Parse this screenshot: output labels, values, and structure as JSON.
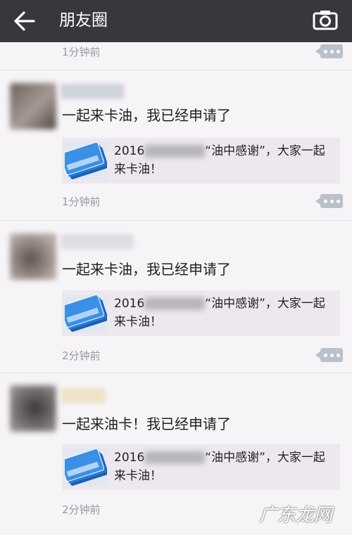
{
  "header": {
    "title": "朋友圈",
    "back_icon": "back-arrow-icon",
    "camera_icon": "camera-icon"
  },
  "top_partial": {
    "time": "1分钟前"
  },
  "posts": [
    {
      "text": "一起来卡油，我已经申请了",
      "card": {
        "prefix": "2016",
        "suffix": "“油中感谢”，大家一起来卡油！"
      },
      "time": "1分钟前"
    },
    {
      "text": "一起来卡油，我已经申请了",
      "card": {
        "prefix": "2016",
        "suffix": "“油中感谢”，大家一起来卡油！"
      },
      "time": "2分钟前"
    },
    {
      "text": "一起来油卡！我已经申请了",
      "card": {
        "prefix": "2016",
        "suffix": "“油中感谢”，大家一起来卡油！"
      },
      "time": "2分钟前"
    }
  ],
  "watermark": "广东龙网",
  "colors": {
    "topbar": "#38373c",
    "background": "#f7f4f8",
    "card": "#ece8ee",
    "more_button": "#b9c1cc"
  }
}
